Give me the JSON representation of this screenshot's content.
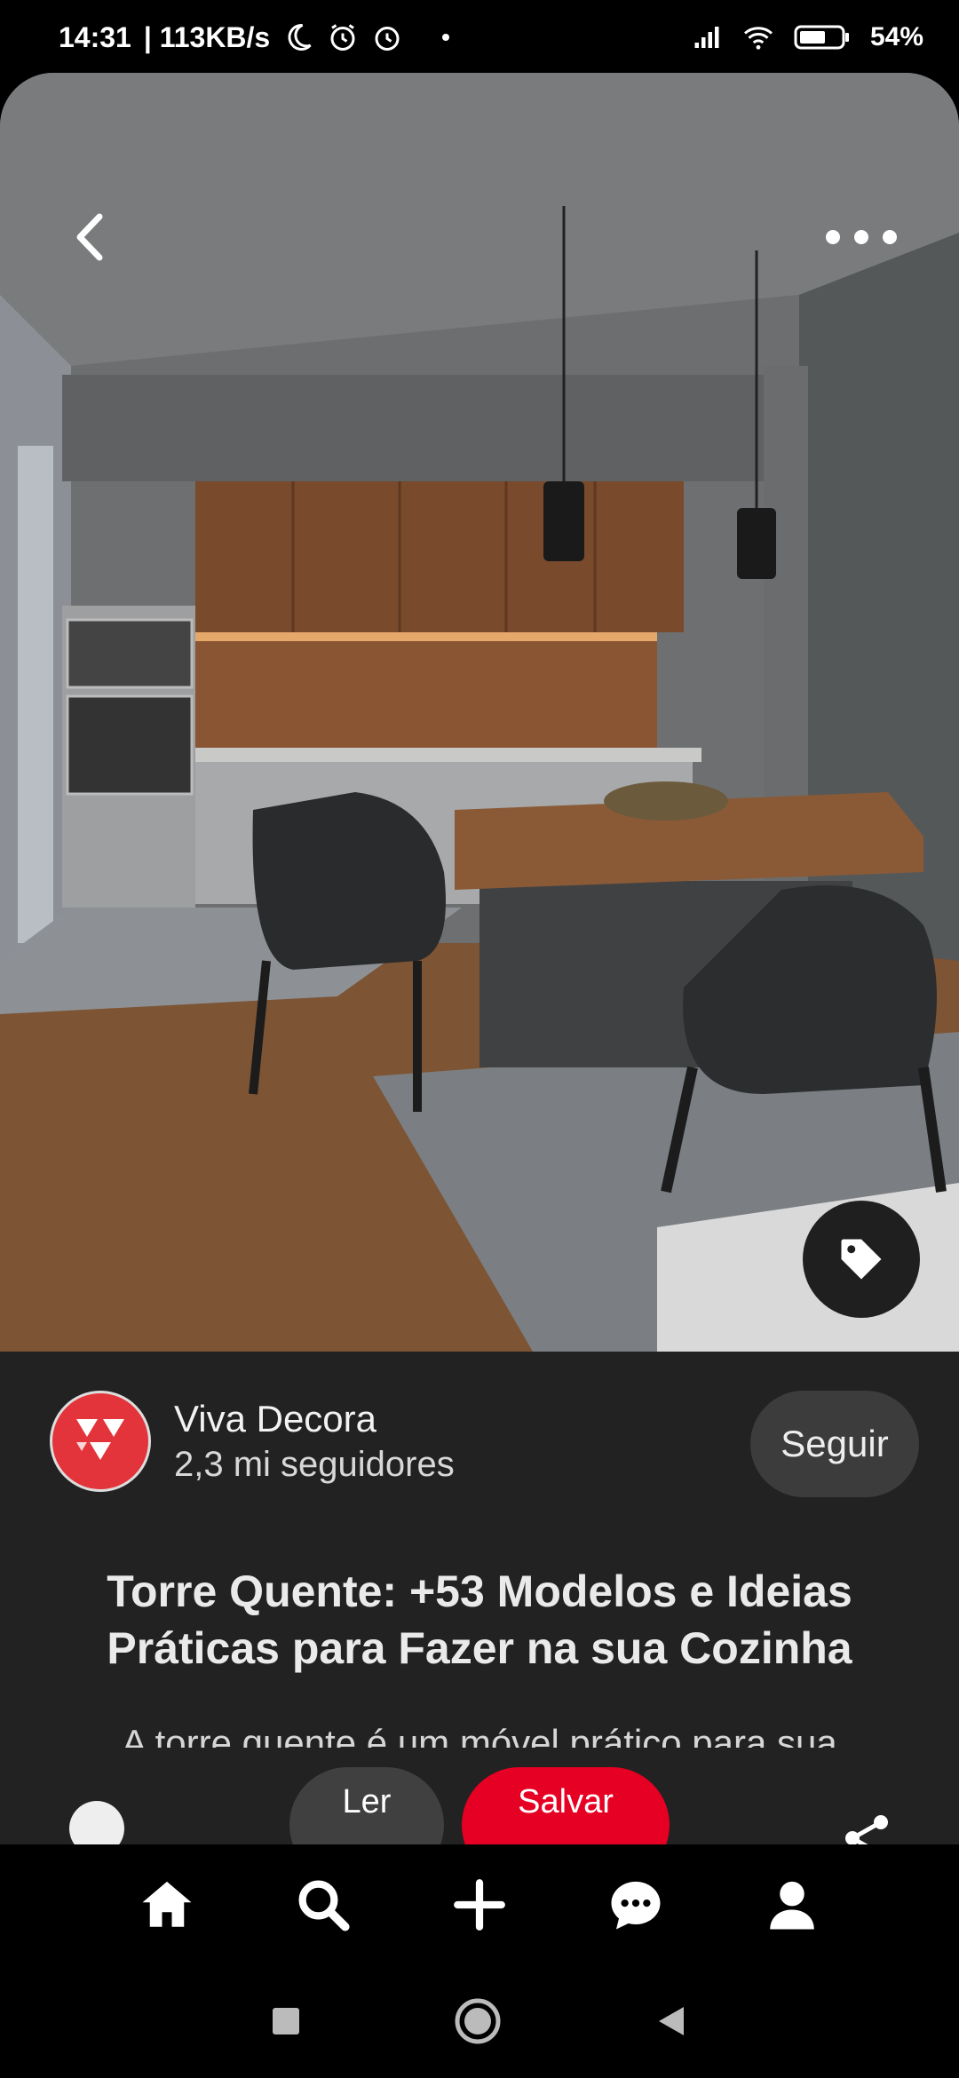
{
  "status_bar": {
    "time": "14:31",
    "network_speed": "| 113KB/s",
    "battery": "54%",
    "icons": [
      "moon-icon",
      "alarm-icon",
      "alarm-icon",
      "dot-icon",
      "signal-icon",
      "wifi-icon",
      "battery-icon"
    ]
  },
  "pin": {
    "image_desc_icon": "tag-icon",
    "creator": {
      "name": "Viva Decora",
      "followers": "2,3 mi seguidores",
      "avatar_color": "#e2343a"
    },
    "follow_label": "Seguir",
    "title": "Torre Quente: +53 Modelos e Ideias Práticas para Fazer na sua Cozinha",
    "description": "A torre quente é um móvel prático para sua"
  },
  "actions": {
    "read_label": "Ler",
    "save_label": "Salvar",
    "save_color": "#e60023"
  },
  "bottom_nav": {
    "items": [
      "home-icon",
      "search-icon",
      "add-icon",
      "messages-icon",
      "profile-icon"
    ]
  },
  "system_nav": [
    "recents-icon",
    "home-circle-icon",
    "back-triangle-icon"
  ]
}
